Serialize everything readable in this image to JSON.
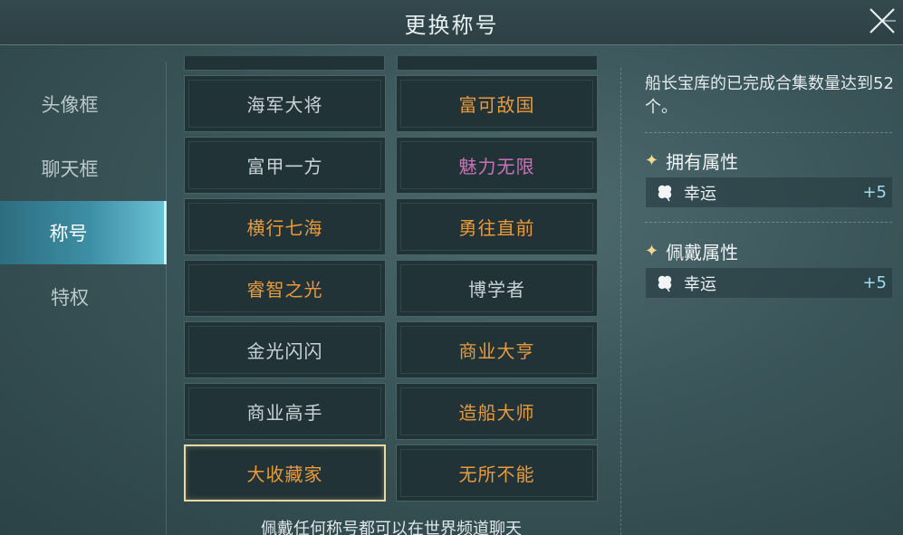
{
  "header": {
    "title": "更换称号"
  },
  "sidebar": {
    "items": [
      {
        "label": "头像框",
        "active": false
      },
      {
        "label": "聊天框",
        "active": false
      },
      {
        "label": "称号",
        "active": true
      },
      {
        "label": "特权",
        "active": false
      }
    ]
  },
  "titles": [
    {
      "label": "海军大将",
      "color": "#c9d3d5"
    },
    {
      "label": "富可敌国",
      "color": "#e89a3c"
    },
    {
      "label": "富甲一方",
      "color": "#c9d3d5"
    },
    {
      "label": "魅力无限",
      "color": "#c872b8"
    },
    {
      "label": "横行七海",
      "color": "#e89a3c"
    },
    {
      "label": "勇往直前",
      "color": "#e89a3c"
    },
    {
      "label": "睿智之光",
      "color": "#e89a3c"
    },
    {
      "label": "博学者",
      "color": "#c9d3d5"
    },
    {
      "label": "金光闪闪",
      "color": "#c9d3d5"
    },
    {
      "label": "商业大亨",
      "color": "#e89a3c"
    },
    {
      "label": "商业高手",
      "color": "#c9d3d5"
    },
    {
      "label": "造船大师",
      "color": "#e89a3c"
    },
    {
      "label": "大收藏家",
      "color": "#e89a3c",
      "selected": true
    },
    {
      "label": "无所不能",
      "color": "#e89a3c"
    }
  ],
  "footer_tip": "佩戴任何称号都可以在世界频道聊天",
  "detail": {
    "description": "船长宝库的已完成合集数量达到52个。",
    "owned_section": {
      "title": "拥有属性",
      "attr": {
        "name": "幸运",
        "value": "+5",
        "icon": "clover-icon"
      }
    },
    "equipped_section": {
      "title": "佩戴属性",
      "attr": {
        "name": "幸运",
        "value": "+5",
        "icon": "clover-icon"
      }
    }
  },
  "icons": {
    "close": "close-icon",
    "star": "sparkle-icon"
  }
}
